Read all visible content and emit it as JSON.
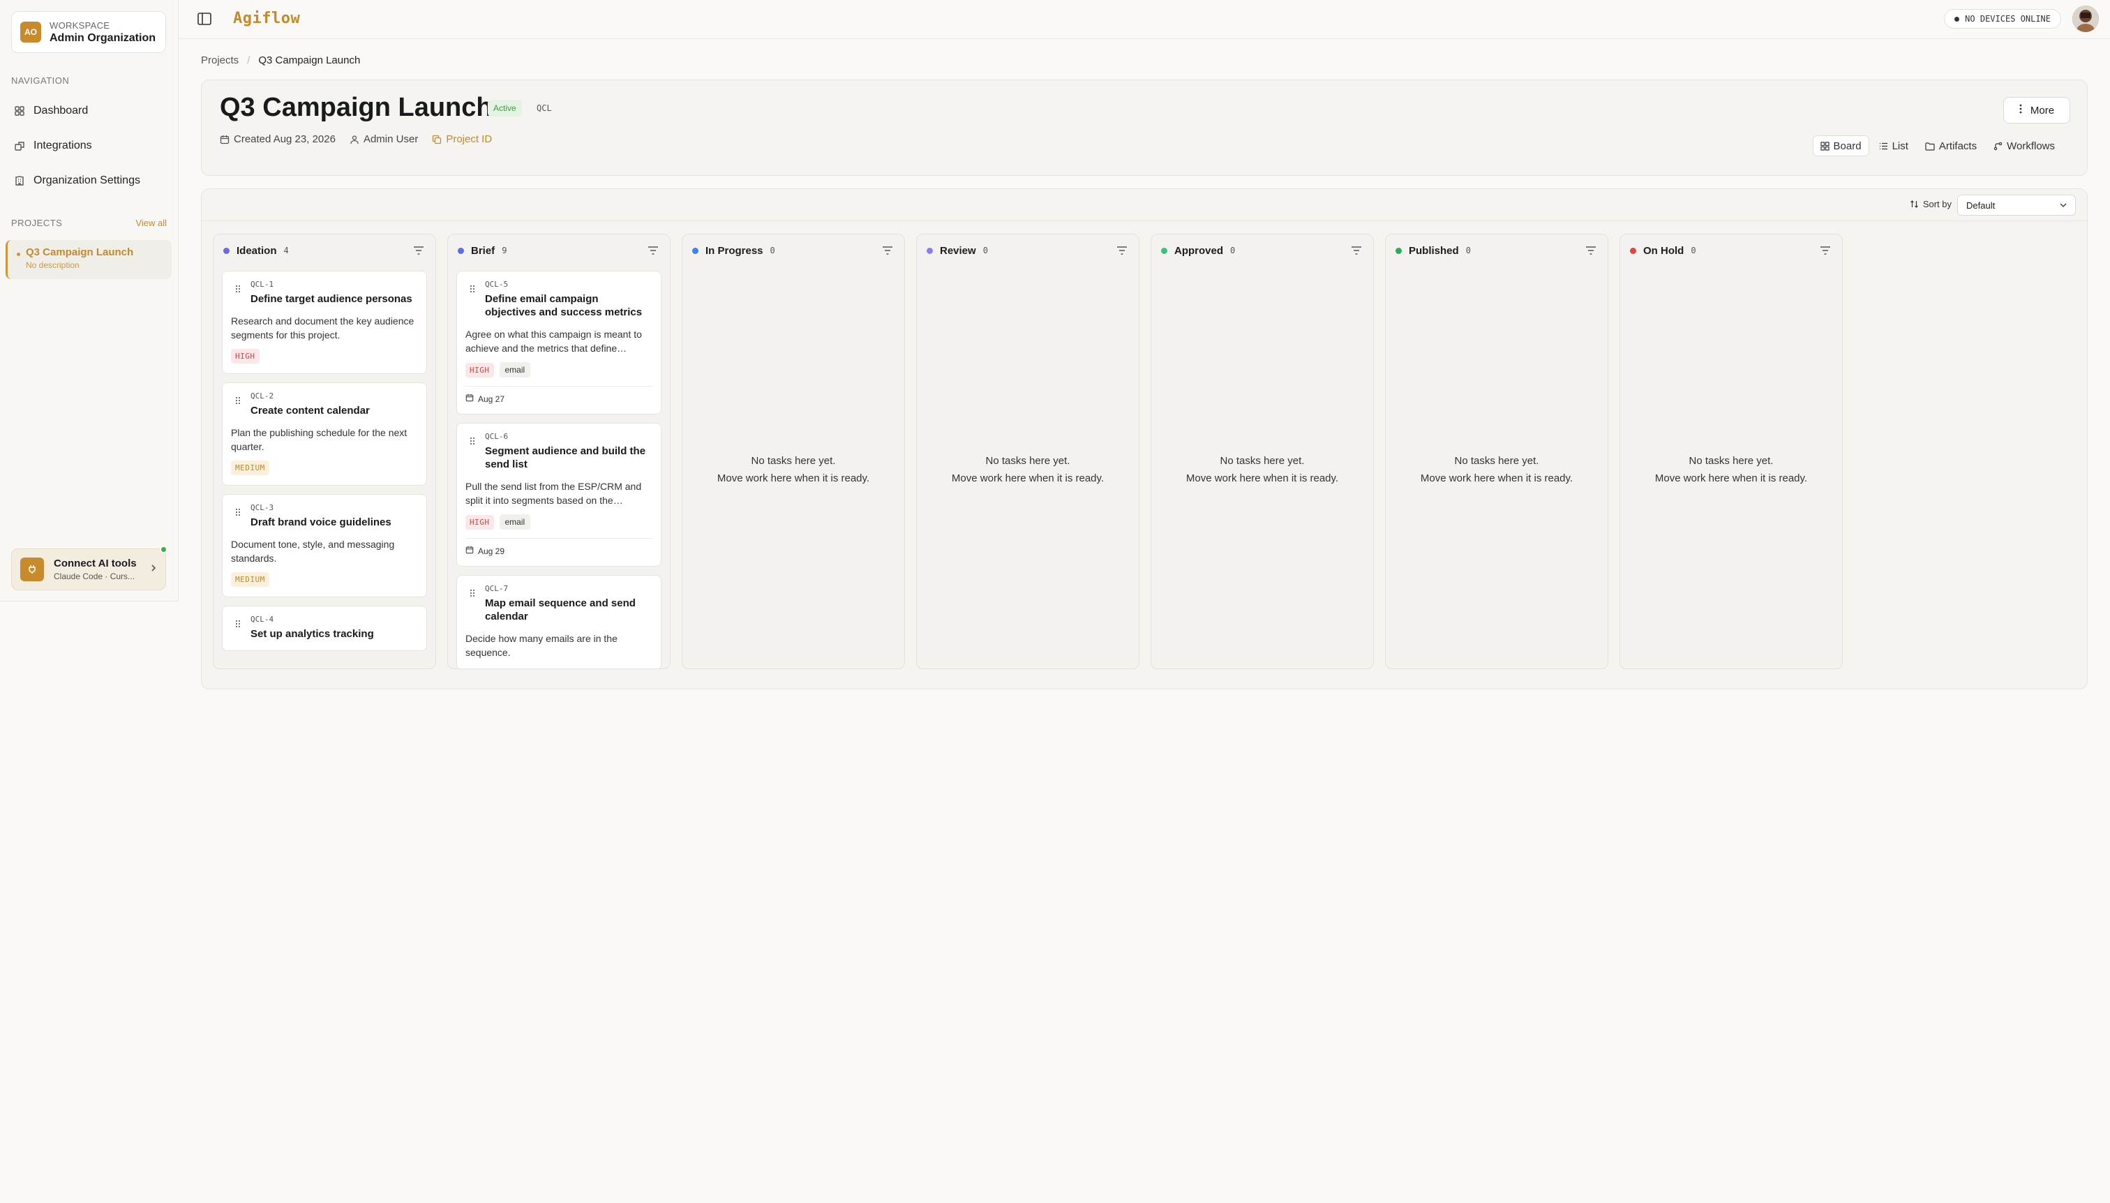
{
  "workspace": {
    "initials": "AO",
    "label": "Workspace",
    "name": "Admin Organization"
  },
  "nav": {
    "heading": "Navigation",
    "items": [
      {
        "label": "Dashboard",
        "icon": "grid-icon"
      },
      {
        "label": "Integrations",
        "icon": "puzzle-icon"
      },
      {
        "label": "Organization Settings",
        "icon": "building-icon"
      }
    ]
  },
  "projects": {
    "heading": "Projects",
    "view_all": "View all",
    "items": [
      {
        "name": "Q3 Campaign Launch",
        "description": "No description"
      }
    ]
  },
  "connect": {
    "title": "Connect AI tools",
    "subtitle": "Claude Code · Curs..."
  },
  "topbar": {
    "logo": "Agiflow",
    "devices": "NO DEVICES ONLINE"
  },
  "breadcrumb": {
    "root": "Projects",
    "current": "Q3 Campaign Launch"
  },
  "project": {
    "title": "Q3 Campaign Launch",
    "status": "Active",
    "key": "QCL",
    "created": "Created Aug 23, 2026",
    "owner": "Admin User",
    "project_id_label": "Project ID",
    "more_label": "More"
  },
  "views": [
    {
      "label": "Board",
      "icon": "board-icon",
      "active": true
    },
    {
      "label": "List",
      "icon": "list-icon",
      "active": false
    },
    {
      "label": "Artifacts",
      "icon": "folder-icon",
      "active": false
    },
    {
      "label": "Workflows",
      "icon": "workflow-icon",
      "active": false
    }
  ],
  "sort": {
    "label": "Sort by",
    "value": "Default"
  },
  "empty_text": {
    "line1": "No tasks here yet.",
    "line2": "Move work here when it is ready."
  },
  "columns": [
    {
      "title": "Ideation",
      "count": "4",
      "color": "#6b67e6",
      "tasks": [
        {
          "key": "QCL-1",
          "title": "Define target audience personas",
          "desc": "Research and document the key audience segments for this project.",
          "priority": "HIGH"
        },
        {
          "key": "QCL-2",
          "title": "Create content calendar",
          "desc": "Plan the publishing schedule for the next quarter.",
          "priority": "MEDIUM"
        },
        {
          "key": "QCL-3",
          "title": "Draft brand voice guidelines",
          "desc": "Document tone, style, and messaging standards.",
          "priority": "MEDIUM"
        },
        {
          "key": "QCL-4",
          "title": "Set up analytics tracking",
          "desc": "",
          "priority": ""
        }
      ]
    },
    {
      "title": "Brief",
      "count": "9",
      "color": "#5b6ee8",
      "tasks": [
        {
          "key": "QCL-5",
          "title": "Define email campaign objectives and success metrics",
          "desc": "Agree on what this campaign is meant to achieve and the metrics that define success.",
          "priority": "HIGH",
          "label": "email",
          "date": "Aug 27"
        },
        {
          "key": "QCL-6",
          "title": "Segment audience and build the send list",
          "desc": "Pull the send list from the ESP/CRM and split it into segments based on the personas.",
          "priority": "HIGH",
          "label": "email",
          "date": "Aug 29"
        },
        {
          "key": "QCL-7",
          "title": "Map email sequence and send calendar",
          "desc": "Decide how many emails are in the sequence.",
          "priority": ""
        }
      ]
    },
    {
      "title": "In Progress",
      "count": "0",
      "color": "#3b82f6",
      "tasks": []
    },
    {
      "title": "Review",
      "count": "0",
      "color": "#8b7ff0",
      "tasks": []
    },
    {
      "title": "Approved",
      "count": "0",
      "color": "#3fbf7f",
      "tasks": []
    },
    {
      "title": "Published",
      "count": "0",
      "color": "#2faa5a",
      "tasks": []
    },
    {
      "title": "On Hold",
      "count": "0",
      "color": "#e04545",
      "tasks": []
    }
  ]
}
